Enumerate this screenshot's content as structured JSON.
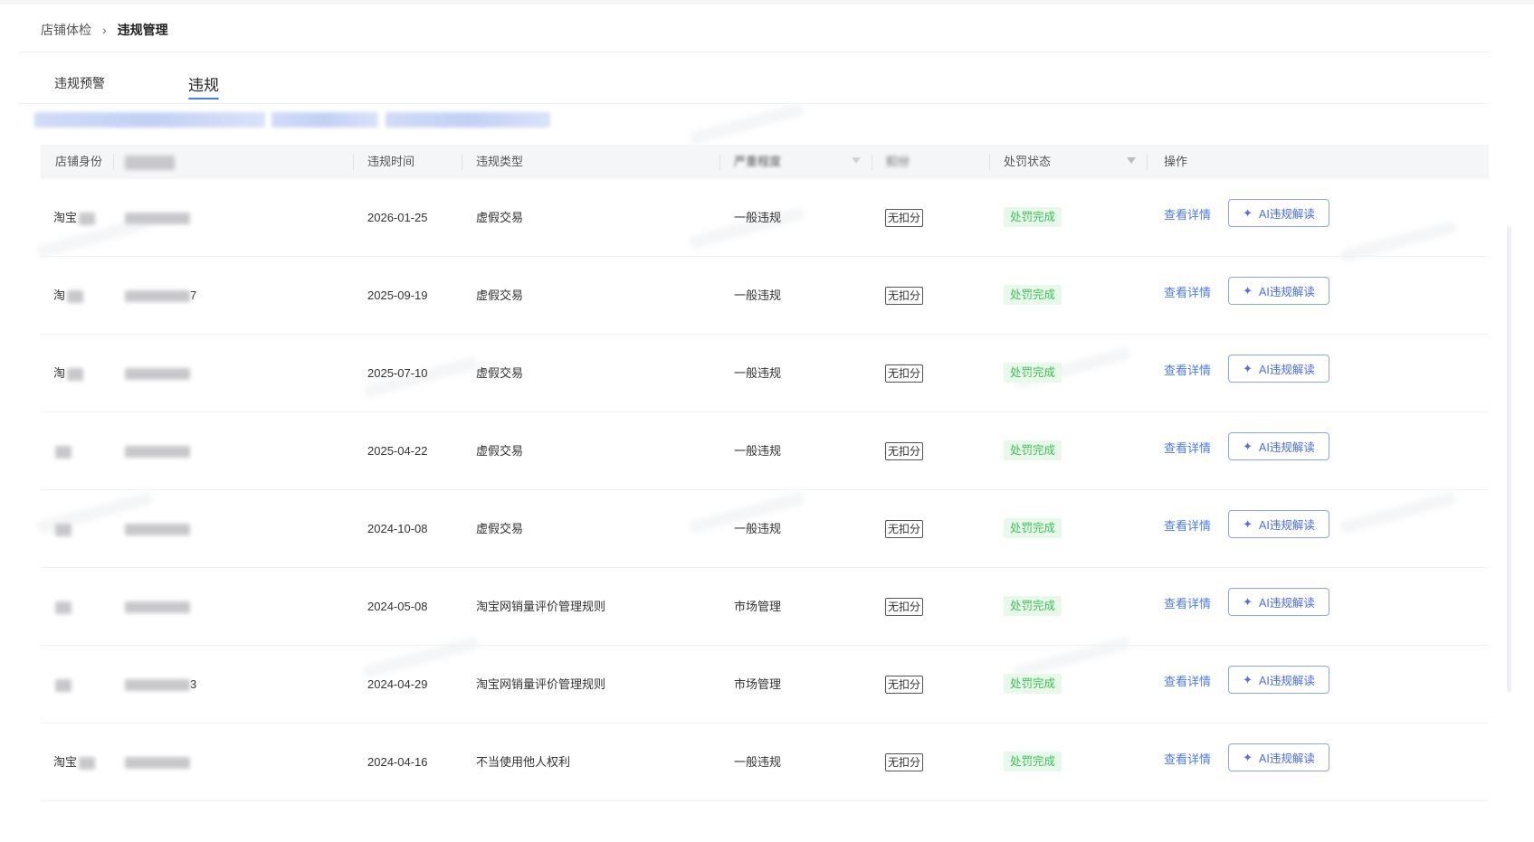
{
  "breadcrumb": {
    "parent": "店铺体检",
    "separator": "›",
    "current": "违规管理"
  },
  "tabs": [
    {
      "label": "违规预警",
      "active": false
    },
    {
      "label": "违规",
      "active": true
    }
  ],
  "table": {
    "headers": {
      "shop_identity": "店铺身份",
      "violation_time": "违规时间",
      "violation_type": "违规类型",
      "severity": "严重程度",
      "deduction": "扣分",
      "penalty_status": "处罚状态",
      "actions": "操作"
    },
    "rows": [
      {
        "shop": "淘宝",
        "time": "2026-01-25",
        "type": "虚假交易",
        "severity": "一般违规",
        "deduction": "无扣分",
        "status": "处罚完成",
        "detail": "查看详情",
        "ai": "AI违规解读"
      },
      {
        "shop": "淘",
        "id_suffix": "7",
        "time": "2025-09-19",
        "type": "虚假交易",
        "severity": "一般违规",
        "deduction": "无扣分",
        "status": "处罚完成",
        "detail": "查看详情",
        "ai": "AI违规解读"
      },
      {
        "shop": "淘",
        "time": "2025-07-10",
        "type": "虚假交易",
        "severity": "一般违规",
        "deduction": "无扣分",
        "status": "处罚完成",
        "detail": "查看详情",
        "ai": "AI违规解读"
      },
      {
        "shop": "",
        "time": "2025-04-22",
        "type": "虚假交易",
        "severity": "一般违规",
        "deduction": "无扣分",
        "status": "处罚完成",
        "detail": "查看详情",
        "ai": "AI违规解读"
      },
      {
        "shop": "",
        "time": "2024-10-08",
        "type": "虚假交易",
        "severity": "一般违规",
        "deduction": "无扣分",
        "status": "处罚完成",
        "detail": "查看详情",
        "ai": "AI违规解读"
      },
      {
        "shop": "",
        "time": "2024-05-08",
        "type": "淘宝网销量评价管理规则",
        "severity": "市场管理",
        "deduction": "无扣分",
        "status": "处罚完成",
        "detail": "查看详情",
        "ai": "AI违规解读"
      },
      {
        "shop": "",
        "id_suffix": "3",
        "time": "2024-04-29",
        "type": "淘宝网销量评价管理规则",
        "severity": "市场管理",
        "deduction": "无扣分",
        "status": "处罚完成",
        "detail": "查看详情",
        "ai": "AI违规解读"
      },
      {
        "shop": "淘宝",
        "time": "2024-04-16",
        "type": "不当使用他人权利",
        "severity": "一般违规",
        "deduction": "无扣分",
        "status": "处罚完成",
        "detail": "查看详情",
        "ai": "AI违规解读"
      }
    ]
  },
  "icons": {
    "filter": "filter-icon",
    "ai": "sparkle-icon"
  },
  "colors": {
    "accent": "#4a7bf5",
    "status_green": "#3cbf55",
    "status_bg": "#e8f8ea"
  }
}
